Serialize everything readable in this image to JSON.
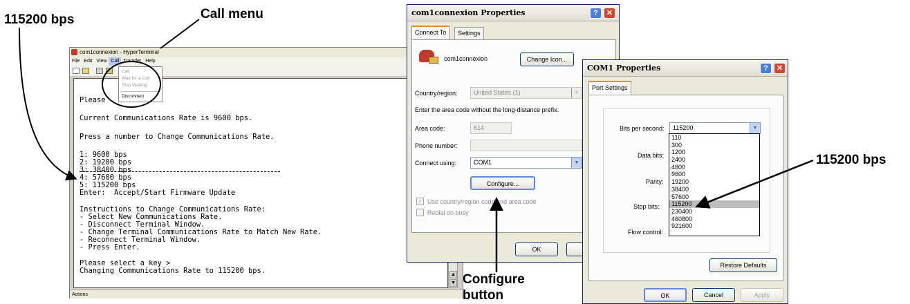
{
  "callouts": {
    "top_left": "115200 bps",
    "call_menu": "Call menu",
    "right": "115200 bps",
    "configure_line1": "Configure",
    "configure_line2": "button"
  },
  "hyperterminal": {
    "title": "com1connexion - HyperTerminal",
    "menus": [
      "File",
      "Edit",
      "View",
      "Call",
      "Transfer",
      "Help"
    ],
    "call_menu_items": [
      "Call",
      "Wait for a Call",
      "Stop Waiting",
      "Disconnect"
    ],
    "terminal_lines": [
      "Please        ?>",
      "Current Communications Rate is 9600 bps.",
      "Press a number to Change Communications Rate.",
      "1: 9600 bps",
      "2: 19200 bps",
      "3: 38400 bps",
      "4: 57600 bps",
      "5: 115200 bps",
      "Enter:  Accept/Start Firmware Update",
      "Instructions to Change Communications Rate:",
      "- Select New Communications Rate.",
      "- Disconnect Terminal Window.",
      "- Change Terminal Communications Rate to Match New Rate.",
      "- Reconnect Terminal Window.",
      "- Press Enter.",
      "Please select a key >",
      "Changing Communications Rate to 115200 bps."
    ],
    "status": "Actions"
  },
  "connection_props": {
    "title": "com1connexion Properties",
    "tabs": [
      "Connect To",
      "Settings"
    ],
    "name": "com1connexion",
    "change_icon": "Change Icon...",
    "country_label": "Country/region:",
    "country_value": "United States (1)",
    "area_hint": "Enter the area code without the long-distance prefix.",
    "area_label": "Area code:",
    "area_value": "614",
    "phone_label": "Phone number:",
    "phone_value": "",
    "connect_label": "Connect using:",
    "connect_value": "COM1",
    "configure": "Configure...",
    "use_country": "Use country/region code and area code",
    "redial": "Redial on busy",
    "ok": "OK",
    "cancel": "Ca"
  },
  "com1_props": {
    "title": "COM1 Properties",
    "tab": "Port Settings",
    "bits_label": "Bits per second:",
    "bits_value": "115200",
    "data_bits_label": "Data bits:",
    "parity_label": "Parity:",
    "stop_bits_label": "Stop bits:",
    "flow_label": "Flow control:",
    "baud_options": [
      "110",
      "300",
      "1200",
      "2400",
      "4800",
      "9600",
      "19200",
      "38400",
      "57600",
      "115200",
      "230400",
      "460800",
      "921600"
    ],
    "selected_option": "115200",
    "restore": "Restore Defaults",
    "ok": "OK",
    "cancel": "Cancel",
    "apply": "Apply"
  },
  "colors": {
    "xp_title_red": "#d9442f",
    "xp_help_blue": "#4a7ee0",
    "dialog_face": "#ece9d8",
    "list_selection": "#bdbdbd"
  }
}
